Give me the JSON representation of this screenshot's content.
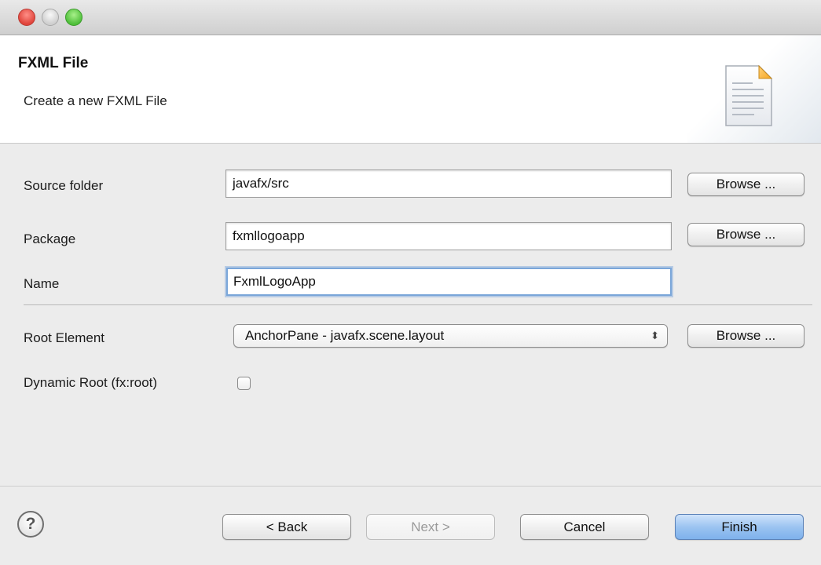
{
  "window": {
    "controls": [
      "close",
      "minimize",
      "maximize"
    ]
  },
  "header": {
    "title": "FXML File",
    "subtitle": "Create a new FXML File",
    "icon": "document-icon"
  },
  "form": {
    "source_folder": {
      "label": "Source folder",
      "value": "javafx/src",
      "browse_label": "Browse ..."
    },
    "package": {
      "label": "Package",
      "value": "fxmllogoapp",
      "browse_label": "Browse ..."
    },
    "name": {
      "label": "Name",
      "value": "FxmlLogoApp"
    },
    "root_element": {
      "label": "Root Element",
      "selected": "AnchorPane - javafx.scene.layout",
      "browse_label": "Browse ..."
    },
    "dynamic_root": {
      "label": "Dynamic Root (fx:root)",
      "checked": false
    }
  },
  "footer": {
    "help_label": "?",
    "back_label": "< Back",
    "next_label": "Next >",
    "cancel_label": "Cancel",
    "finish_label": "Finish"
  },
  "colors": {
    "default_button": "#8fbcf0",
    "focus_ring": "#7aa6d9"
  }
}
